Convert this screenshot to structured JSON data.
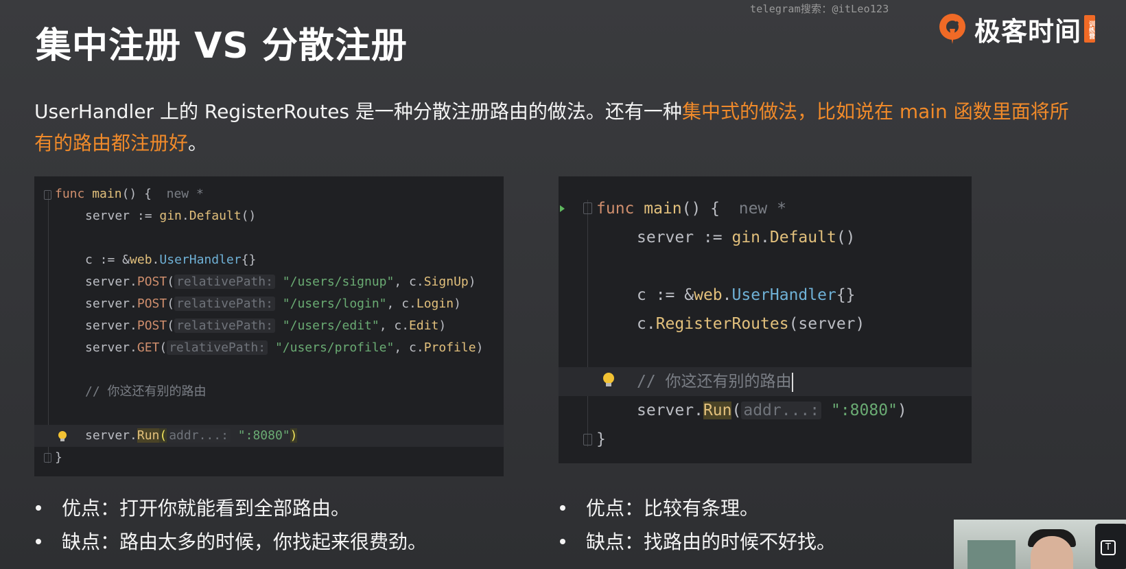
{
  "watermark": "telegram搜索：@itLeo123",
  "logo": {
    "text": "极客时间",
    "tag": "训练营"
  },
  "title": "集中注册 VS 分散注册",
  "intro": {
    "plain_1": "UserHandler 上的 RegisterRoutes 是一种分散注册路由的做法。还有一种",
    "highlight": "集中式的做法，比如说在 main 函数里面将所有的路由都注册好",
    "plain_2": "。"
  },
  "colors": {
    "accent": "#f08a2a",
    "background": "#36373a",
    "code_bg": "#1f2023"
  },
  "left_code": {
    "l1_func": "func",
    "l1_main": "main",
    "l1_rest": "() {",
    "l1_new": "new *",
    "l2_a": "server := ",
    "l2_gin": "gin",
    "l2_dot": ".",
    "l2_default": "Default",
    "l2_paren": "()",
    "l4_a": "c := &",
    "l4_web": "web",
    "l4_dot": ".",
    "l4_type": "UserHandler",
    "l4_b": "{}",
    "r1_a": "server.",
    "r1_m": "POST",
    "r1_p": "(",
    "r1_hint": "relativePath:",
    "r1_s": "\"/users/signup\"",
    "r1_c": ", c.",
    "r1_f": "SignUp",
    "r1_e": ")",
    "r2_a": "server.",
    "r2_m": "POST",
    "r2_p": "(",
    "r2_hint": "relativePath:",
    "r2_s": "\"/users/login\"",
    "r2_c": ", c.",
    "r2_f": "Login",
    "r2_e": ")",
    "r3_a": "server.",
    "r3_m": "POST",
    "r3_p": "(",
    "r3_hint": "relativePath:",
    "r3_s": "\"/users/edit\"",
    "r3_c": ", c.",
    "r3_f": "Edit",
    "r3_e": ")",
    "r4_a": "server.",
    "r4_m": "GET",
    "r4_p": "(",
    "r4_hint": "relativePath:",
    "r4_s": "\"/users/profile\"",
    "r4_c": ", c.",
    "r4_f": "Profile",
    "r4_e": ")",
    "comment": "// 你这还有别的路由",
    "run_a": "server.",
    "run_f": "Run",
    "run_p": "(",
    "run_hint": "addr...:",
    "run_s": "\":8080\"",
    "run_e": ")",
    "close": "}"
  },
  "right_code": {
    "l1_func": "func",
    "l1_main": "main",
    "l1_rest": "() {",
    "l1_new": "new *",
    "l2_a": "server := ",
    "l2_gin": "gin",
    "l2_dot": ".",
    "l2_default": "Default",
    "l2_paren": "()",
    "l4_a": "c := &",
    "l4_web": "web",
    "l4_dot": ".",
    "l4_type": "UserHandler",
    "l4_b": "{}",
    "l5_a": "c.",
    "l5_f": "RegisterRoutes",
    "l5_b": "(server)",
    "comment": "// 你这还有别的路由",
    "run_a": "server.",
    "run_f": "Run",
    "run_p": "(",
    "run_hint": "addr...:",
    "run_s": "\":8080\"",
    "run_e": ")",
    "close": "}"
  },
  "left_bullets": [
    "优点：打开你就能看到全部路由。",
    "缺点：路由太多的时候，你找起来很费劲。"
  ],
  "right_bullets": [
    "优点：比较有条理。",
    "缺点：找路由的时候不好找。"
  ],
  "webcam_icon": "T"
}
